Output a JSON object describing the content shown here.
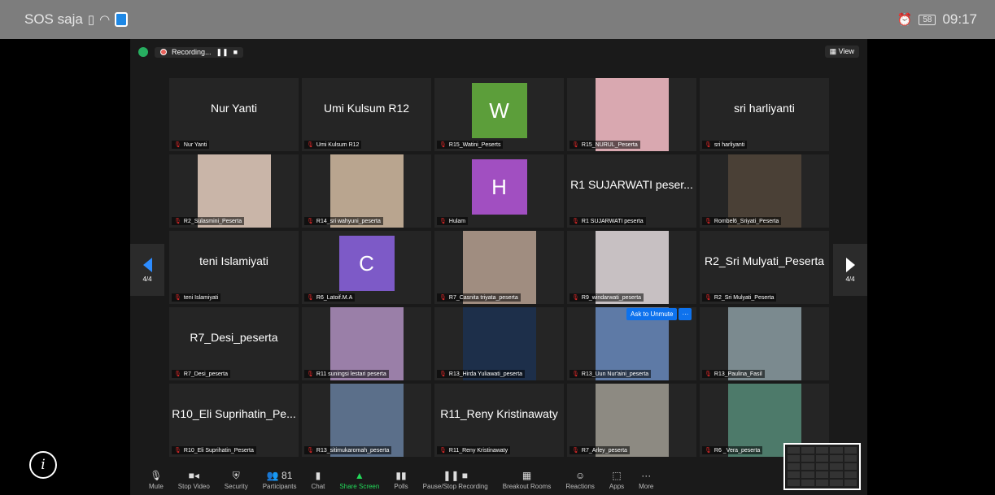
{
  "statusbar": {
    "carrier": "SOS saja",
    "battery": "58",
    "time": "09:17"
  },
  "meeting": {
    "recording_label": "Recording...",
    "pause_glyph": "❚❚",
    "stop_glyph": "■",
    "view_label": "View",
    "page_left": "4/4",
    "page_right": "4/4",
    "unmute_label": "Ask to Unmute",
    "unmute_more": "···"
  },
  "tiles": [
    {
      "kind": "name",
      "big": "Nur Yanti",
      "label": "Nur Yanti"
    },
    {
      "kind": "name",
      "big": "Umi Kulsum R12",
      "label": "Umi Kulsum R12"
    },
    {
      "kind": "avatar",
      "letter": "W",
      "color": "#5c9e3a",
      "label": "R15_Watini_Peserts"
    },
    {
      "kind": "video",
      "color": "#d9a8b0",
      "label": "R15_NURUL_Peserta"
    },
    {
      "kind": "name",
      "big": "sri harliyanti",
      "label": "sri harliyanti"
    },
    {
      "kind": "video",
      "color": "#c9b5a8",
      "label": "R2_Sulasmini_Peserta"
    },
    {
      "kind": "video",
      "color": "#b9a58f",
      "label": "R14_sri wahyuni_peserta"
    },
    {
      "kind": "avatar",
      "letter": "H",
      "color": "#a14fc1",
      "label": "Hulam"
    },
    {
      "kind": "name",
      "big": "R1 SUJARWATI peser...",
      "label": "R1 SUJARWATI peserta"
    },
    {
      "kind": "video",
      "color": "#4a4036",
      "label": "Rombel6_Sriyati_Peserta"
    },
    {
      "kind": "name",
      "big": "teni Islamiyati",
      "label": "teni Islamiyati"
    },
    {
      "kind": "avatar",
      "letter": "C",
      "color": "#7d5ac7",
      "label": "R6_Latoif.M.A"
    },
    {
      "kind": "video",
      "color": "#a08d80",
      "label": "R7_Casnita triyata_peserta"
    },
    {
      "kind": "video",
      "color": "#c7c0c2",
      "label": "R9_windarwati_peserta"
    },
    {
      "kind": "name",
      "big": "R2_Sri Mulyati_Peserta",
      "label": "R2_Sri Mulyati_Peserta"
    },
    {
      "kind": "name",
      "big": "R7_Desi_peserta",
      "label": "R7_Desi_peserta"
    },
    {
      "kind": "video",
      "color": "#9a7fa8",
      "label": "R11 suningsi lestari peserta"
    },
    {
      "kind": "video",
      "color": "#1d2f4a",
      "label": "R13_Hirda Yuliawati_peserta"
    },
    {
      "kind": "video",
      "color": "#5e7aa6",
      "label": "R13_Uun Nur'aini_peserta"
    },
    {
      "kind": "video",
      "color": "#7b8a8f",
      "label": "R13_Paulina_Fasil"
    },
    {
      "kind": "name",
      "big": "R10_Eli Suprihatin_Pe...",
      "label": "R10_Eli Suprihatin_Peserta"
    },
    {
      "kind": "video",
      "color": "#5b6f8a",
      "label": "R13_sitimukaromah_peserta"
    },
    {
      "kind": "name",
      "big": "R11_Reny Kristinawaty",
      "label": "R11_Reny Kristinawaty"
    },
    {
      "kind": "video",
      "color": "#8d8a82",
      "label": "R7_Arley_peserta"
    },
    {
      "kind": "video",
      "color": "#4d7a6a",
      "label": "R6 _Vera_peserta"
    }
  ],
  "toolbar": [
    {
      "name": "mute-button",
      "glyph": "🎙",
      "label": "Mute"
    },
    {
      "name": "stop-video-button",
      "glyph": "■◂",
      "label": "Stop Video"
    },
    {
      "name": "security-button",
      "glyph": "⛨",
      "label": "Security"
    },
    {
      "name": "participants-button",
      "glyph": "👥 81",
      "label": "Participants"
    },
    {
      "name": "chat-button",
      "glyph": "▮",
      "label": "Chat"
    },
    {
      "name": "share-screen-button",
      "glyph": "▲",
      "label": "Share Screen",
      "green": true
    },
    {
      "name": "polls-button",
      "glyph": "▮▮",
      "label": "Polls"
    },
    {
      "name": "pause-stop-recording-button",
      "glyph": "❚❚ ■",
      "label": "Pause/Stop Recording"
    },
    {
      "name": "breakout-rooms-button",
      "glyph": "▦",
      "label": "Breakout Rooms"
    },
    {
      "name": "reactions-button",
      "glyph": "☺",
      "label": "Reactions"
    },
    {
      "name": "apps-button",
      "glyph": "⬚",
      "label": "Apps"
    },
    {
      "name": "more-button",
      "glyph": "···",
      "label": "More"
    }
  ]
}
